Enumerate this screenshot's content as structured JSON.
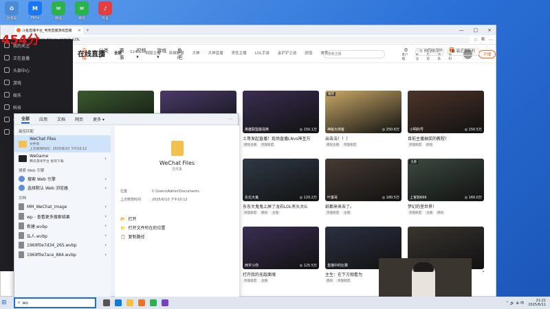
{
  "desktop": {
    "icons": [
      {
        "label": "回收站",
        "color": "#4a8ad6",
        "glyph": "♻"
      },
      {
        "label": "Meta",
        "color": "#1877f2",
        "glyph": "M"
      },
      {
        "label": "微信",
        "color": "#2bb24c",
        "glyph": "✉"
      },
      {
        "label": "微信",
        "color": "#2bb24c",
        "glyph": "✉"
      },
      {
        "label": "抖音",
        "color": "#e43d3d",
        "glyph": "♪"
      }
    ]
  },
  "score_overlay": "454分",
  "browser": {
    "tab": {
      "title": "斗鱼直播平台_电竞直播游戏直播",
      "close": "×"
    },
    "new_tab": "+",
    "url": "https://www.douyu.com/g_LOL",
    "window_controls": [
      "—",
      "□",
      "×"
    ]
  },
  "site": {
    "logo": "斗鱼",
    "nav": [
      "首页",
      "直播",
      "分类 ▾",
      "赛事",
      "视频 ▾",
      "游戏 ▾",
      "鱼吧"
    ],
    "active_nav": "直播",
    "search_placeholder": "搜索主播",
    "header_icons": [
      {
        "g": "⚙",
        "label": "客户端"
      },
      {
        "g": "♡",
        "label": "关注"
      },
      {
        "g": "◷",
        "label": "历史"
      },
      {
        "g": "✉",
        "label": "消息"
      },
      {
        "g": "🎁",
        "label": "福利"
      }
    ],
    "live_button": "开播"
  },
  "sidebar": {
    "items": [
      "我的关注",
      "正在直播",
      "头部中心",
      "游戏",
      "娱乐",
      "科技",
      "体育",
      "更多"
    ]
  },
  "main": {
    "title": "在线直播",
    "categories": [
      "全部",
      "S14",
      "韩服主播",
      "英雄联盟",
      "大神",
      "大神直播",
      "男性主播",
      "LOL手游",
      "金铲铲之战",
      "颜值",
      "美食"
    ],
    "active_category": "全部",
    "buttons": [
      "☰ 热门排序",
      "▦ 最近更新的"
    ]
  },
  "cards": [
    {
      "title": "土哥发起直播！现场直播LNvs神圣万",
      "anchor": "英雄联盟最强英",
      "hot": "◎ 150.1万",
      "tag": "",
      "tags": [
        "模拟主播",
        "英雄联盟"
      ],
      "color": "#3a2e52"
    },
    {
      "title": "出击法！！！",
      "anchor": "神秘大侠客",
      "hot": "◎ 250.6万",
      "tag": "推荐",
      "tags": [
        "模拟主播",
        "英雄联盟"
      ],
      "color": "#c9a867"
    },
    {
      "title": "目前主播抽奖的教程！",
      "anchor": "小明的号",
      "hot": "◎ 150.5万",
      "tag": "",
      "tags": [
        "英雄联盟",
        "颜值"
      ],
      "color": "#4d3429"
    },
    {
      "title": "东东大鬼鬼上屏了龙石LOL有头大G",
      "anchor": "东北大鬼",
      "hot": "◎ 120.2万",
      "tag": "",
      "tags": [
        "英雄联盟",
        "模拟",
        "主播"
      ],
      "color": "#2f3a46"
    },
    {
      "title": "纸都来来去了。",
      "anchor": "叶童哥",
      "hot": "◎ 180.5万",
      "tag": "",
      "tags": [
        "英雄联盟",
        "主播"
      ],
      "color": "#473b34"
    },
    {
      "title": "梦幻的里世界！",
      "anchor": "上官如666",
      "hot": "◎ 160.0万",
      "tag": "主题",
      "tags": [
        "英雄联盟",
        "主播",
        "模拟"
      ],
      "color": "#3b4a40"
    },
    {
      "title": "打开我的无敌面魂",
      "anchor": "西字斗你",
      "hot": "◎ 125.5万",
      "tag": "",
      "tags": [
        "英雄联盟",
        "主播"
      ],
      "color": "#3a2e52"
    },
    {
      "title": "主生：在下方观看为",
      "anchor": "直播中的比赛",
      "hot": "◎ 133.2万",
      "tag": "",
      "tags": [
        "模拟",
        "英雄联盟"
      ],
      "color": "#2c3142"
    },
    {
      "title": "",
      "anchor": "",
      "hot": "",
      "tag": "",
      "tags": [],
      "color": "#39352f"
    }
  ],
  "explorer": {
    "tabs": [
      "全部",
      "应用",
      "文档",
      "网页",
      "更多 ▾"
    ],
    "active_tab": "全部",
    "tools": "⋯",
    "best_match_label": "最佳匹配",
    "best_match": {
      "title": "WeChat Files",
      "type": "文件夹",
      "date": "上次修改时间：2025/6/10 下午10:12"
    },
    "apps": [
      {
        "title": "WeGame",
        "sub": "腾讯游戏平台 发现下载"
      }
    ],
    "web_label": "搜索 Web 引擎",
    "web_items": [
      "搜索 Web 引擎",
      "选择默认 Web 浏览器"
    ],
    "docs_label": "文档",
    "doc_items": [
      "MM_WeChat_Image",
      "wp - 查看更多搜索结果",
      "新建.wvbp",
      "弘人.wvbp",
      "1969f0e7d34_265.wvbp",
      "1969f0e7ace_884.wvbp"
    ],
    "preview": {
      "title": "WeChat Files",
      "type": "文件夹",
      "location_label": "位置",
      "location": "C:\\Users\\Admin\\Documents",
      "modified_label": "上次修改时间",
      "modified": "2025/6/10 下午10:12",
      "actions": [
        "打开",
        "打开文件所在的位置",
        "复制路径"
      ]
    }
  },
  "taskbar": {
    "search_value": "wo",
    "time": "21:21",
    "date": "2025/6/11",
    "tray_text": "⌃ 🔊 ⊕ 中"
  }
}
